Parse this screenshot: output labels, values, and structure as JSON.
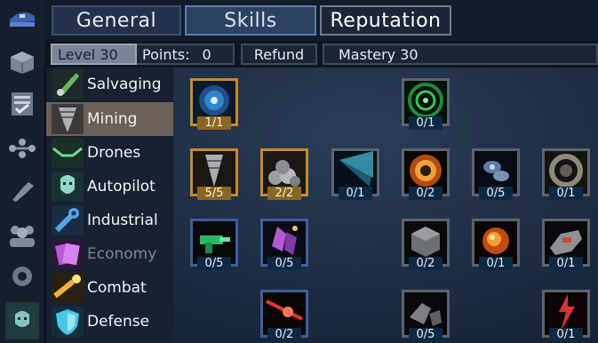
{
  "tabs": [
    {
      "label": "General"
    },
    {
      "label": "Skills"
    },
    {
      "label": "Reputation"
    }
  ],
  "info": {
    "level": "Level 30",
    "points_label": "Points:",
    "points_value": "0",
    "refund": "Refund",
    "mastery": "Mastery 30"
  },
  "categories": [
    {
      "label": "Salvaging",
      "icon": "salvaging-icon"
    },
    {
      "label": "Mining",
      "icon": "drill-icon"
    },
    {
      "label": "Drones",
      "icon": "drones-icon"
    },
    {
      "label": "Autopilot",
      "icon": "pilot-portrait-icon"
    },
    {
      "label": "Industrial",
      "icon": "wrench-icon"
    },
    {
      "label": "Economy",
      "icon": "cards-icon"
    },
    {
      "label": "Combat",
      "icon": "cannon-icon"
    },
    {
      "label": "Defense",
      "icon": "shield-icon"
    }
  ],
  "skills": [
    {
      "count": "1/1",
      "icon": "scanner-orb-icon"
    },
    {
      "count": "0/1",
      "icon": "green-radar-icon"
    },
    {
      "count": "5/5",
      "icon": "drill-bit-icon"
    },
    {
      "count": "2/2",
      "icon": "ore-pile-icon"
    },
    {
      "count": "0/1",
      "icon": "light-beam-icon"
    },
    {
      "count": "0/2",
      "icon": "explosion-icon"
    },
    {
      "count": "0/5",
      "icon": "drone-pod-icon"
    },
    {
      "count": "0/1",
      "icon": "swirl-icon"
    },
    {
      "count": "0/5",
      "icon": "green-gun-icon"
    },
    {
      "count": "0/5",
      "icon": "crystal-icon"
    },
    {
      "count": "0/2",
      "icon": "cargo-crate-icon"
    },
    {
      "count": "0/1",
      "icon": "fire-blast-icon"
    },
    {
      "count": "0/1",
      "icon": "spaceship-icon"
    },
    {
      "count": "0/2",
      "icon": "red-laser-icon"
    },
    {
      "count": "0/5",
      "icon": "debris-icon"
    },
    {
      "count": "0/1",
      "icon": "lightning-icon"
    }
  ],
  "sidebar_icons": [
    "captain-hat-icon",
    "cargo-box-icon",
    "checklist-icon",
    "skill-tree-icon",
    "tool-icon",
    "crew-icon",
    "settings-gear-icon",
    "player-portrait-icon"
  ],
  "colors": {
    "gold_frame": "#c68a2c",
    "blue_frame": "#3b5e9c",
    "selected_category": "#6b6159"
  }
}
